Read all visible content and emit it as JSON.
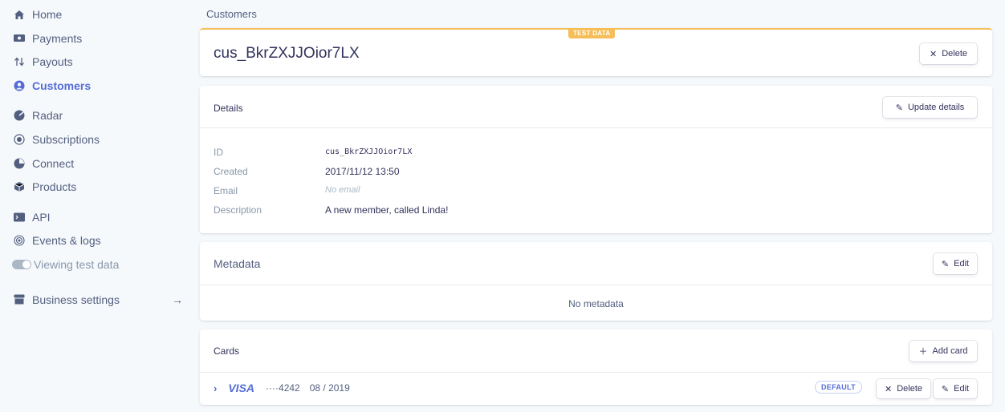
{
  "sidebar": {
    "items": [
      {
        "label": "Home",
        "icon": "home-icon"
      },
      {
        "label": "Payments",
        "icon": "payments-icon"
      },
      {
        "label": "Payouts",
        "icon": "payouts-icon"
      },
      {
        "label": "Customers",
        "icon": "customers-icon"
      },
      {
        "label": "Radar",
        "icon": "radar-icon"
      },
      {
        "label": "Subscriptions",
        "icon": "subscriptions-icon"
      },
      {
        "label": "Connect",
        "icon": "connect-icon"
      },
      {
        "label": "Products",
        "icon": "products-icon"
      },
      {
        "label": "API",
        "icon": "api-icon"
      },
      {
        "label": "Events & logs",
        "icon": "events-icon"
      },
      {
        "label": "Viewing test data",
        "icon": "toggle-icon"
      },
      {
        "label": "Business settings",
        "icon": "business-icon",
        "arrow": "→"
      }
    ]
  },
  "breadcrumb": "Customers",
  "header": {
    "test_badge": "TEST DATA",
    "title": "cus_BkrZXJJOior7LX",
    "delete_label": "Delete"
  },
  "details": {
    "title": "Details",
    "update_label": "Update details",
    "rows": [
      {
        "label": "ID",
        "value": "cus_BkrZXJJOior7LX"
      },
      {
        "label": "Created",
        "value": "2017/11/12 13:50"
      },
      {
        "label": "Email",
        "value": "No email"
      },
      {
        "label": "Description",
        "value": "A new member, called Linda!"
      }
    ]
  },
  "metadata": {
    "title": "Metadata",
    "edit_label": "Edit",
    "empty": "No metadata"
  },
  "cards": {
    "title": "Cards",
    "add_label": "Add card",
    "items": [
      {
        "brand": "VISA",
        "last4": "····4242",
        "exp": "08 / 2019",
        "badge": "DEFAULT",
        "delete_label": "Delete",
        "edit_label": "Edit"
      }
    ]
  },
  "colors": {
    "accent": "#556cd6",
    "test_badge": "#f5be58",
    "background": "#f6f9fc"
  }
}
